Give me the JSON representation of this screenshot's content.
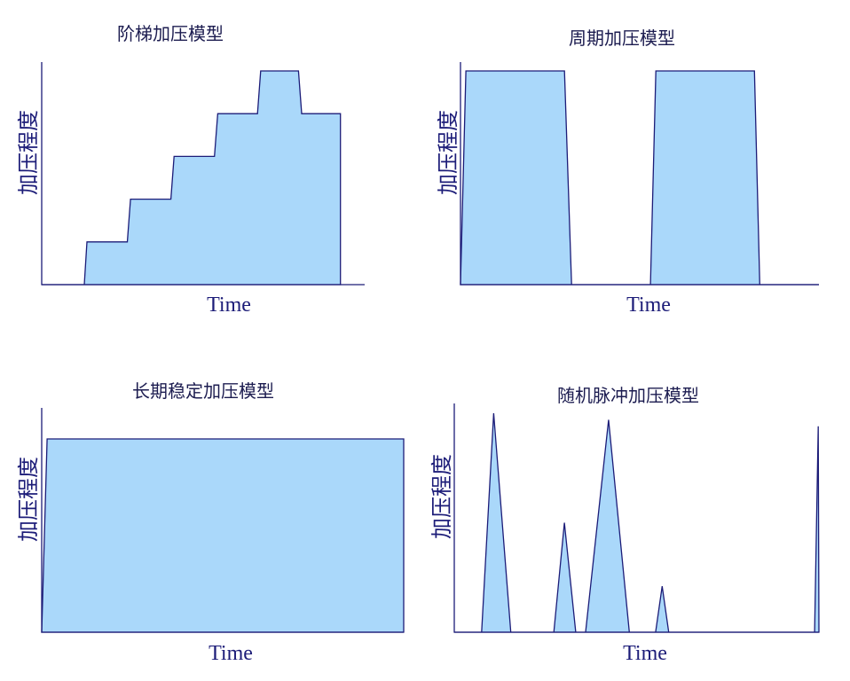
{
  "chart_data": [
    {
      "type": "area",
      "title": "阶梯加压模型",
      "xlabel": "Time",
      "ylabel": "加压程度",
      "grid": false,
      "xlim": [
        0,
        100
      ],
      "ylim": [
        0,
        100
      ],
      "series": [
        {
          "x": [
            0,
            13.2,
            14,
            26.5,
            27.5,
            40,
            41,
            53.5,
            54.5,
            66.8,
            67.8,
            79.5,
            80.5,
            92.5,
            92.5
          ],
          "y": [
            0,
            0,
            20,
            20,
            40,
            40,
            60,
            60,
            80,
            80,
            100,
            100,
            80,
            80,
            0
          ]
        }
      ]
    },
    {
      "type": "area",
      "title": "周期加压模型",
      "xlabel": "Time",
      "ylabel": "加压程度",
      "grid": false,
      "xlim": [
        0,
        100
      ],
      "ylim": [
        0,
        100
      ],
      "series": [
        {
          "x": [
            0,
            1.5,
            29,
            31,
            53,
            54.5,
            82,
            83.5,
            100
          ],
          "y": [
            0,
            100,
            100,
            0,
            0,
            100,
            100,
            0,
            0
          ]
        }
      ]
    },
    {
      "type": "area",
      "title": "长期稳定加压模型",
      "xlabel": "Time",
      "ylabel": "",
      "grid": false,
      "xlim": [
        0,
        100
      ],
      "ylim": [
        0,
        100
      ],
      "series": [
        {
          "x": [
            0,
            1.5,
            100,
            100
          ],
          "y": [
            0,
            100,
            100,
            0
          ]
        }
      ]
    },
    {
      "type": "area",
      "title": "随机脉冲加压模型",
      "xlabel": "Time",
      "ylabel": "加压程度",
      "grid": false,
      "xlim": [
        0,
        100
      ],
      "ylim": [
        0,
        100
      ],
      "series": [
        {
          "x": [
            0,
            7.5,
            10.8,
            15.5,
            27.3,
            30.2,
            33.3,
            36,
            42.3,
            48,
            55.2,
            57,
            58.8,
            98.8,
            99.8,
            100
          ],
          "y": [
            0,
            0,
            100,
            0,
            0,
            50,
            0,
            0,
            97,
            0,
            0,
            21,
            0,
            0,
            94,
            0
          ]
        }
      ]
    }
  ]
}
